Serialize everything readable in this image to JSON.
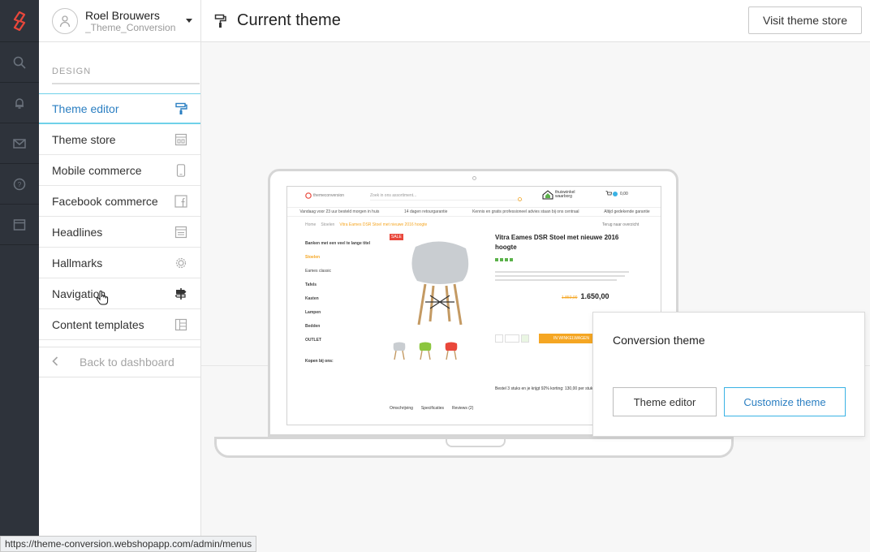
{
  "user": {
    "name": "Roel Brouwers",
    "shop": "_Theme_Conversion"
  },
  "sidebar": {
    "section_title": "DESIGN",
    "items": [
      {
        "label": "Theme editor",
        "icon": "paint-roller-icon",
        "active": true
      },
      {
        "label": "Theme store",
        "icon": "store-icon"
      },
      {
        "label": "Mobile commerce",
        "icon": "mobile-icon"
      },
      {
        "label": "Facebook commerce",
        "icon": "facebook-icon"
      },
      {
        "label": "Headlines",
        "icon": "headlines-icon"
      },
      {
        "label": "Hallmarks",
        "icon": "hallmark-badge-icon"
      },
      {
        "label": "Navigation",
        "icon": "signpost-icon"
      },
      {
        "label": "Content templates",
        "icon": "template-icon"
      }
    ],
    "back_label": "Back to dashboard"
  },
  "header": {
    "title": "Current theme",
    "visit_button": "Visit theme store"
  },
  "popup": {
    "title": "Conversion theme",
    "theme_editor_button": "Theme editor",
    "customize_button": "Customize theme"
  },
  "preview": {
    "logo": "themeconversion",
    "search_placeholder": "Zoek in ons assortiment...",
    "badge": "thuiswinkel waarborg",
    "cart": "0,00",
    "usps": [
      "Vandaag voor 23 uur besteld morgen in huis",
      "14 dagen retourgarantie",
      "Kennis en gratis professioneel advies staan bij ons centraal",
      "Altijd gedekende garantie"
    ],
    "breadcrumb": [
      "Home",
      "Stoelen",
      "Vitra Eames DSR Stoel met nieuwe 2016 hoogte"
    ],
    "compare_link": "Terug naar overzicht",
    "categories": [
      "Banken met een veel te lange titel",
      "Stoelen",
      "Eames classic",
      "Tafels",
      "Kasten",
      "Lampen",
      "Bedden",
      "OUTLET"
    ],
    "sale": "SALE",
    "product_title": "Vitra Eames DSR Stoel met nieuwe 2016 hoogte",
    "price_old": "1.850,00",
    "price": "1.650,00",
    "tabs": [
      "Omschrijving",
      "Specificaties",
      "Reviews (2)"
    ],
    "shop_at": "Kopen bij ons:",
    "cart_button": "IN WINKELWAGEN",
    "bulk": "Bestel 3 stuks en je krijgt 92% korting: 130,00 per stuk"
  },
  "status_url": "https://theme-conversion.webshopapp.com/admin/menus",
  "colors": {
    "accent": "#2b7fc2",
    "active_border": "#6fd1e9",
    "rail": "#2e333b",
    "brand": "#e9473b",
    "orange": "#f5a623"
  }
}
